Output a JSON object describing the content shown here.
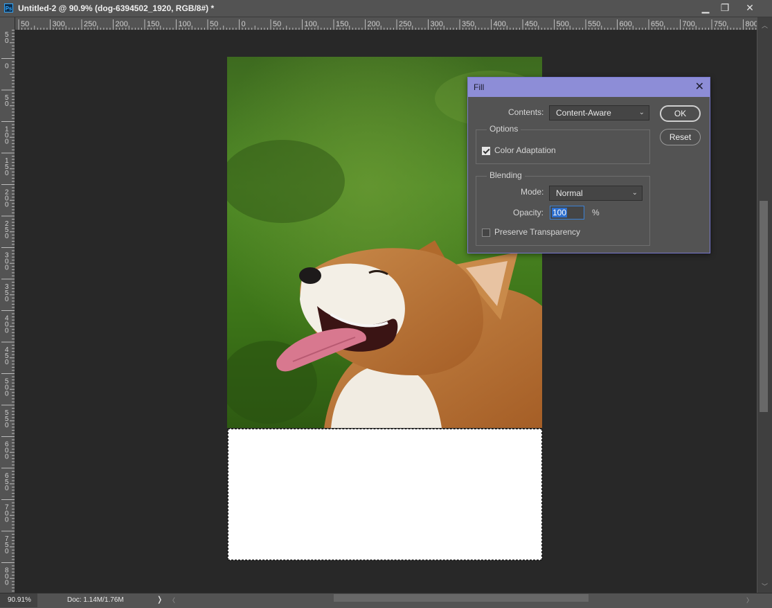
{
  "window": {
    "title": "Untitled-2 @ 90.9% (dog-6394502_1920, RGB/8#) *",
    "app_icon_text": "Ps",
    "controls": [
      "minimize-icon",
      "maximize-icon",
      "close-icon"
    ]
  },
  "rulers": {
    "horizontal_labels": [
      "50",
      "300",
      "250",
      "200",
      "150",
      "100",
      "50",
      "0",
      "50",
      "100",
      "150",
      "200",
      "250",
      "300",
      "350",
      "400",
      "450",
      "500",
      "550",
      "600",
      "650",
      "700",
      "750",
      "800"
    ],
    "vertical_labels": [
      "5\n0",
      "0",
      "5\n0",
      "1\n0\n0",
      "1\n5\n0",
      "2\n0\n0",
      "2\n5\n0",
      "3\n0\n0",
      "3\n5\n0",
      "4\n0\n0",
      "4\n5\n0",
      "5\n0\n0",
      "5\n5\n0",
      "6\n0\n0",
      "6\n5\n0",
      "7\n0\n0",
      "7\n5\n0",
      "8\n0\n0"
    ]
  },
  "status": {
    "zoom": "90.91%",
    "doc_info": "Doc: 1.14M/1.76M",
    "arrow": "❭"
  },
  "dialog": {
    "title": "Fill",
    "contents_label": "Contents:",
    "contents_value": "Content-Aware",
    "ok_label": "OK",
    "reset_label": "Reset",
    "options_legend": "Options",
    "color_adaptation_label": "Color Adaptation",
    "color_adaptation_checked": true,
    "blending_legend": "Blending",
    "mode_label": "Mode:",
    "mode_value": "Normal",
    "opacity_label": "Opacity:",
    "opacity_value": "100",
    "percent": "%",
    "preserve_label": "Preserve Transparency",
    "preserve_checked": false
  },
  "colors": {
    "dialog_title_bar": "#8d8dd7",
    "canvas_bg": "#282828",
    "panel_bg": "#535353"
  }
}
